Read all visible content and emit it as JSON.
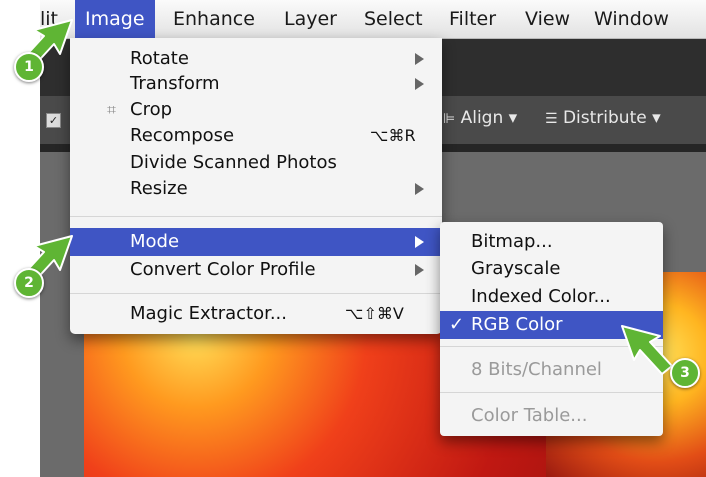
{
  "menubar": {
    "items": [
      {
        "label": "lit"
      },
      {
        "label": "Image"
      },
      {
        "label": "Enhance"
      },
      {
        "label": "Layer"
      },
      {
        "label": "Select"
      },
      {
        "label": "Filter"
      },
      {
        "label": "View"
      },
      {
        "label": "Window"
      }
    ]
  },
  "options_bar": {
    "align_label": "Align",
    "distribute_label": "Distribute"
  },
  "image_menu": {
    "items": [
      {
        "label": "Rotate",
        "submenu": true
      },
      {
        "label": "Transform",
        "submenu": true
      },
      {
        "label": "Crop",
        "icon": "crop-icon"
      },
      {
        "label": "Recompose",
        "shortcut": "⌥⌘R"
      },
      {
        "label": "Divide Scanned Photos"
      },
      {
        "label": "Resize",
        "submenu": true
      },
      {
        "label": "Mode",
        "submenu": true,
        "highlighted": true
      },
      {
        "label": "Convert Color Profile",
        "submenu": true
      },
      {
        "label": "Magic Extractor...",
        "shortcut": "⌥⇧⌘V"
      }
    ]
  },
  "mode_submenu": {
    "items": [
      {
        "label": "Bitmap..."
      },
      {
        "label": "Grayscale"
      },
      {
        "label": "Indexed Color..."
      },
      {
        "label": "RGB Color",
        "checked": true,
        "check": "✓"
      },
      {
        "label": "8 Bits/Channel",
        "disabled": true
      },
      {
        "label": "Color Table...",
        "disabled": true
      }
    ]
  },
  "callouts": [
    "1",
    "2",
    "3"
  ],
  "colors": {
    "highlight": "#3f55c4",
    "badge": "#5fb534"
  }
}
